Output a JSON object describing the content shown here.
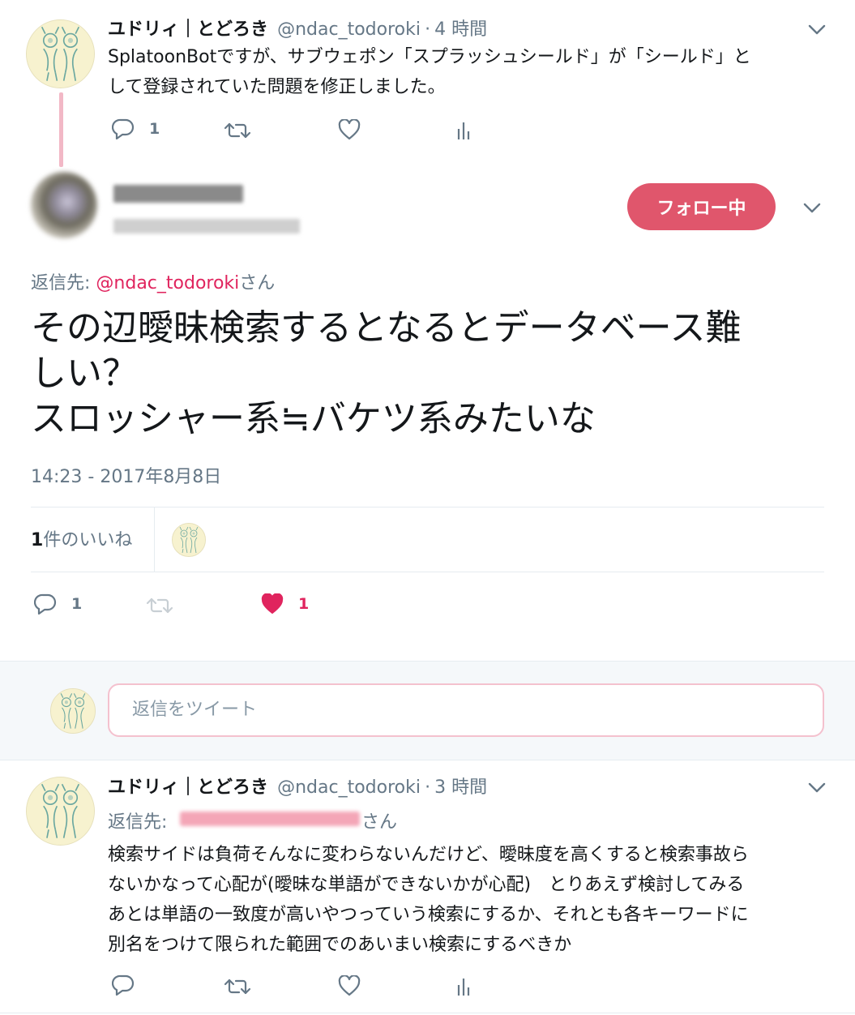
{
  "tweet1": {
    "name": "ユドリィ｜とどろき",
    "handle": "@ndac_todoroki",
    "separator": "·",
    "time": "4 時間",
    "lines": [
      "SplatoonBotですが、サブウェポン「スプラッシュシールド」が「シールド」と",
      "して登録されていた問題を修正しました。"
    ],
    "reply_count": "1"
  },
  "main_tweet": {
    "follow_label": "フォロー中",
    "reply_to_prefix": "返信先: ",
    "reply_to_handle": "@ndac_todoroki",
    "reply_to_suffix": "さん",
    "lines": [
      "その辺曖昧検索するとなるとデータベース難",
      "しい？",
      "スロッシャー系≒バケツ系みたいな"
    ],
    "timestamp": "14:23 - 2017年8月8日",
    "likes_number": "1",
    "likes_label": "件のいいね",
    "reply_count": "1",
    "like_count": "1"
  },
  "reply_box": {
    "placeholder": "返信をツイート"
  },
  "tweet3": {
    "name": "ユドリィ｜とどろき",
    "handle": "@ndac_todoroki",
    "separator": "·",
    "time": "3 時間",
    "reply_to_prefix": "返信先: ",
    "reply_to_suffix": "さん",
    "lines": [
      "検索サイドは負荷そんなに変わらないんだけど、曖昧度を高くすると検索事故ら",
      "ないかなって心配が(曖昧な単語ができないかが心配)　とりあえず検討してみる",
      "あとは単語の一致度が高いやつっていう検索にするか、それとも各キーワードに",
      "別名をつけて限られた範囲でのあいまい検索にするべきか"
    ]
  },
  "colors": {
    "accent_pink": "#e0245e",
    "follow_button": "#e0566c",
    "gray_text": "#657786",
    "thread_line": "#f2b8c6"
  }
}
